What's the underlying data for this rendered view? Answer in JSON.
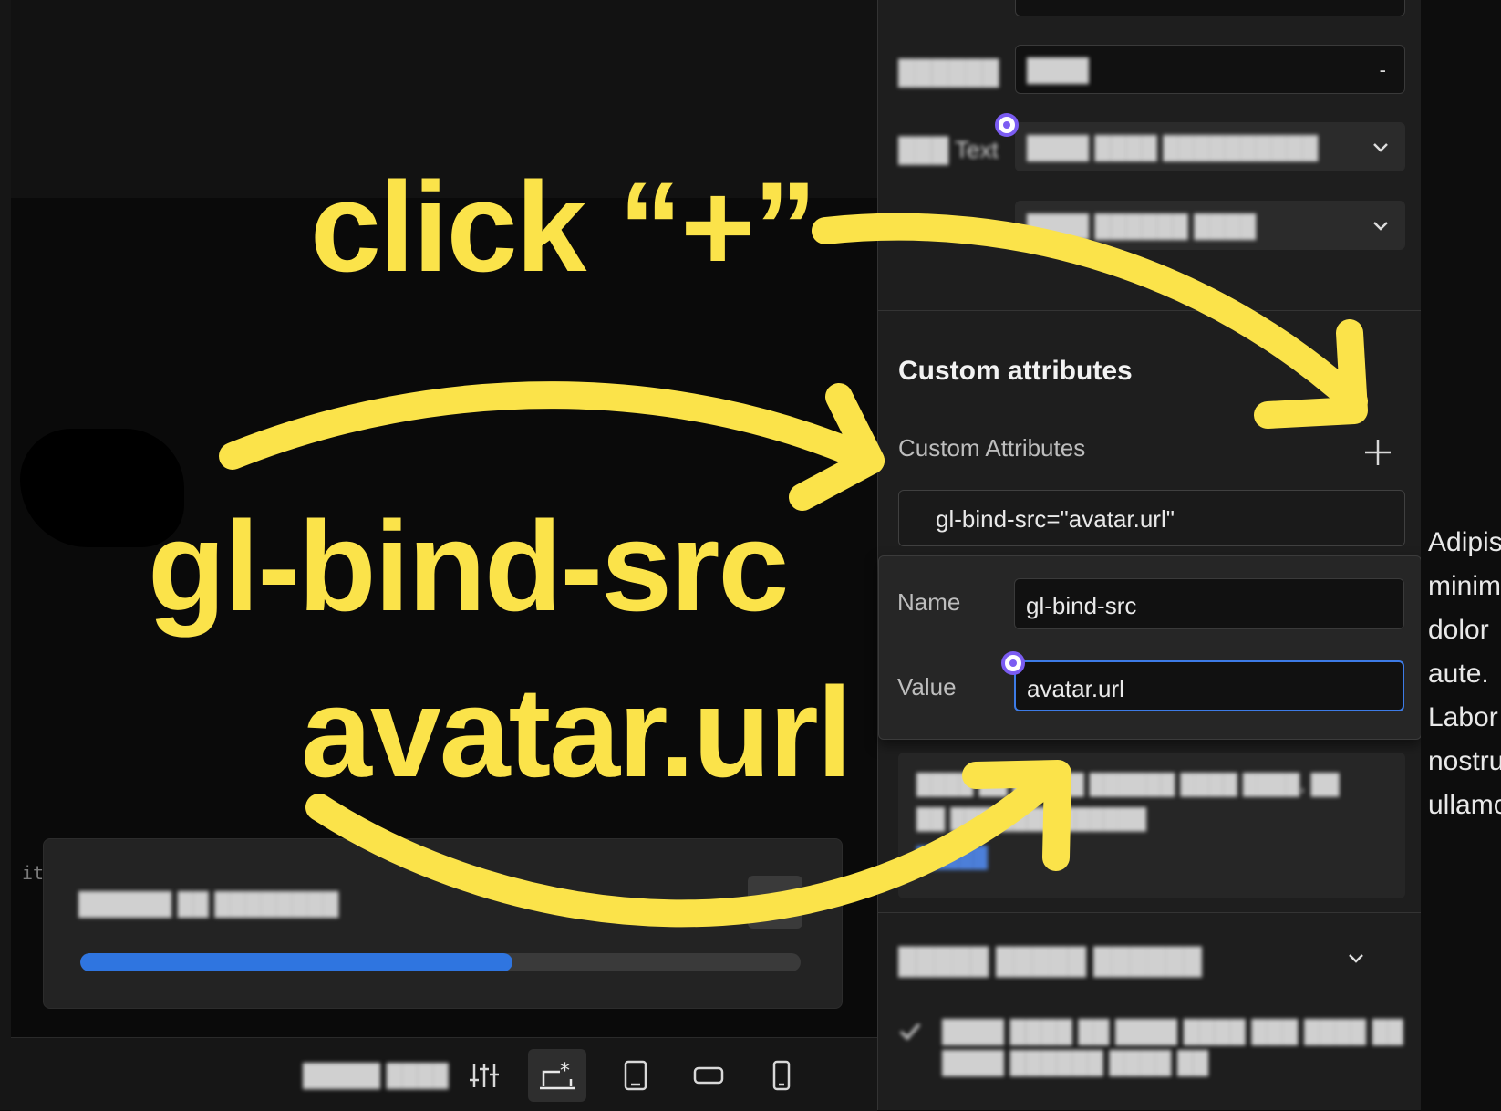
{
  "annotations": {
    "click_text": "click “+”",
    "name_text": "gl-bind-src",
    "value_text": "avatar.url"
  },
  "canvas": {
    "code_snippet": "ite"
  },
  "toast": {
    "message": "██████ ██ ████████",
    "more_label": "...",
    "progress": 0.6
  },
  "bottom_bar": {
    "zoom_text": "█████ ████"
  },
  "panel": {
    "fields": [
      {
        "label": "██████",
        "value": "████",
        "suffix": "-"
      },
      {
        "label": "███ Text",
        "value": "████ ████ ██████████"
      },
      {
        "label": "",
        "value": "████ ██████ ████"
      }
    ],
    "custom_attributes": {
      "heading": "Custom attributes",
      "subheading": "Custom Attributes",
      "entry": "gl-bind-src=\"avatar.url\"",
      "name_label": "Name",
      "name_value": "gl-bind-src",
      "value_label": "Value",
      "value_value": "avatar.url"
    },
    "hint": {
      "line1": "████ ██ █████ ██████ ████ ████, ██",
      "line2": "██ ███ ████ ██████",
      "link": "█████"
    },
    "section2": {
      "heading": "█████ █████ ██████",
      "line1": "████ ████ ██ ████ ████ ███ ████ ██",
      "line2": "████ ██████ ████ ██"
    }
  },
  "preview": {
    "lines": [
      "Adipis",
      "minim",
      "dolor",
      "aute.",
      "Labor",
      "nostru",
      "ullamc"
    ]
  },
  "colors": {
    "annotation": "#fbe34a",
    "accent_blue": "#2f75e0",
    "purple_dot": "#7b5cf2"
  }
}
